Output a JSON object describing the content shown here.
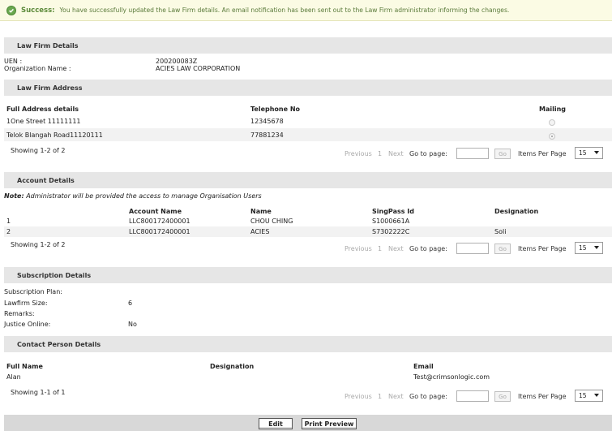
{
  "success": {
    "label": "Success:",
    "message": "You have successfully updated the Law Firm details. An email notification has been sent out to the Law Firm administrator informing the changes."
  },
  "law_firm_details": {
    "header": "Law Firm Details",
    "uen_label": "UEN :",
    "uen_value": "200200083Z",
    "org_label": "Organization Name :",
    "org_value": "ACIES LAW CORPORATION"
  },
  "law_firm_address": {
    "header": "Law Firm Address",
    "columns": [
      "Full Address details",
      "Telephone No",
      "Mailing"
    ],
    "rows": [
      {
        "address": "1One Street 11111111",
        "phone": "12345678",
        "mailing": false
      },
      {
        "address": "Telok Blangah Road11120111",
        "phone": "77881234",
        "mailing": true
      }
    ],
    "pager": {
      "showing": "Showing 1-2 of 2",
      "previous": "Previous",
      "page": "1",
      "next": "Next",
      "goto": "Go to page:",
      "go": "Go",
      "items_per_page": "Items Per Page",
      "per_page_value": "15"
    }
  },
  "account_details": {
    "header": "Account Details",
    "note_label": "Note:",
    "note_text": "Administrator will be provided the access to manage Organisation Users",
    "columns": [
      "Account Name",
      "Name",
      "SingPass Id",
      "Designation"
    ],
    "rows": [
      {
        "no": "1",
        "account": "LLC800172400001",
        "name": "CHOU CHING",
        "singpass": "S1000661A",
        "designation": ""
      },
      {
        "no": "2",
        "account": "LLC800172400001",
        "name": "ACIES",
        "singpass": "S7302222C",
        "designation": "Soli"
      }
    ],
    "pager": {
      "showing": "Showing 1-2 of 2",
      "previous": "Previous",
      "page": "1",
      "next": "Next",
      "goto": "Go to page:",
      "go": "Go",
      "items_per_page": "Items Per Page",
      "per_page_value": "15"
    }
  },
  "subscription": {
    "header": "Subscription Details",
    "plan_label": "Subscription Plan:",
    "plan_value": "",
    "size_label": "Lawfirm Size:",
    "size_value": "6",
    "remarks_label": "Remarks:",
    "remarks_value": "",
    "justice_label": "Justice Online:",
    "justice_value": "No"
  },
  "contact": {
    "header": "Contact Person Details",
    "columns": [
      "Full Name",
      "Designation",
      "Email"
    ],
    "rows": [
      {
        "name": "Alan",
        "designation": "",
        "email": "Test@crimsonlogic.com"
      }
    ],
    "pager": {
      "showing": "Showing 1-1 of 1",
      "previous": "Previous",
      "page": "1",
      "next": "Next",
      "goto": "Go to page:",
      "go": "Go",
      "items_per_page": "Items Per Page",
      "per_page_value": "15"
    }
  },
  "footer": {
    "edit": "Edit",
    "print_preview": "Print Preview"
  },
  "icons": {
    "success": "check-circle-icon",
    "dropdown": "caret-down-icon"
  },
  "colors": {
    "success_bg": "#fbfbe4",
    "success_text": "#5c8a3a",
    "section_bg": "#e6e6e6"
  }
}
